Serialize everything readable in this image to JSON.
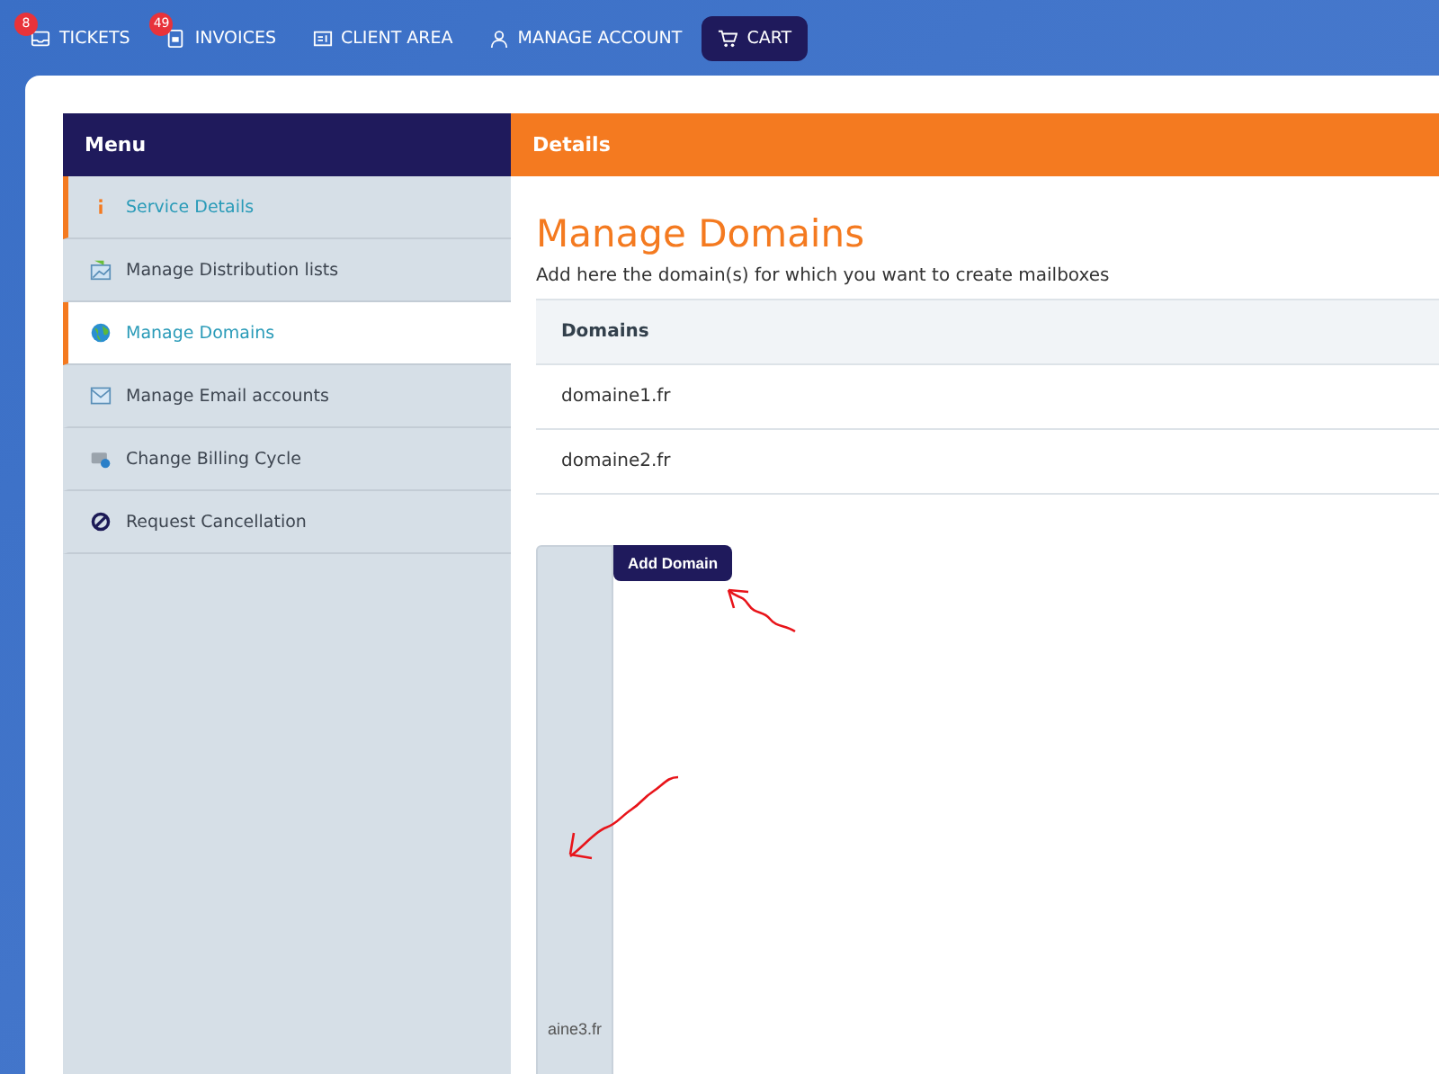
{
  "nav": [
    {
      "label": "TICKETS",
      "badge": "8",
      "selected": false
    },
    {
      "label": "INVOICES",
      "badge": "49",
      "selected": false
    },
    {
      "label": "CLIENT AREA",
      "selected": false
    },
    {
      "label": "MANAGE ACCOUNT",
      "selected": false
    },
    {
      "label": "CART",
      "selected": true
    }
  ],
  "menu": {
    "title": "Menu",
    "items": [
      {
        "label": "Service Details",
        "selected": false,
        "marked": true
      },
      {
        "label": "Manage Distribution lists",
        "selected": false,
        "marked": false
      },
      {
        "label": "Manage Domains",
        "selected": true,
        "marked": true
      },
      {
        "label": "Manage Email accounts",
        "selected": false,
        "marked": false
      },
      {
        "label": "Change Billing Cycle",
        "selected": false,
        "marked": false
      },
      {
        "label": "Request Cancellation",
        "selected": false,
        "marked": false
      }
    ]
  },
  "details": {
    "title": "Details",
    "heading": "Manage Domains",
    "intro": "Add here the domain(s) for which you want to create mailboxes",
    "table": {
      "columns": [
        "Domains"
      ],
      "rows": [
        "domaine1.fr",
        "domaine2.fr"
      ]
    },
    "field": {
      "value": "aine3.fr"
    },
    "add_button": "Add Domain"
  }
}
